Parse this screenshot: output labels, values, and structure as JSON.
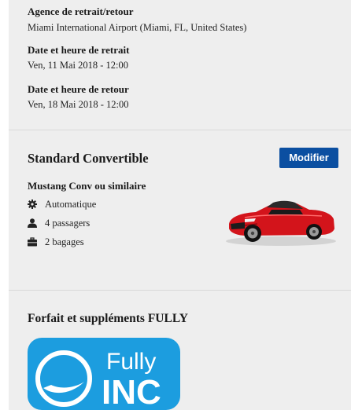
{
  "pickup": {
    "agency_label": "Agence de retrait/retour",
    "agency_value": "Miami International Airport (Miami, FL, United States)",
    "pickup_label": "Date et heure de retrait",
    "pickup_value": "Ven, 11 Mai 2018 - 12:00",
    "return_label": "Date et heure de retour",
    "return_value": "Ven, 18 Mai 2018 - 12:00"
  },
  "vehicle": {
    "category": "Standard Convertible",
    "edit_label": "Modifier",
    "model": "Mustang Conv ou similaire",
    "features": [
      {
        "icon": "gear-icon",
        "label": "Automatique"
      },
      {
        "icon": "person-icon",
        "label": "4 passagers"
      },
      {
        "icon": "suitcase-icon",
        "label": "2 bagages"
      }
    ],
    "car_color": "#d3141b"
  },
  "package": {
    "title": "Forfait et suppléments FULLY",
    "logo_line1": "Fully",
    "logo_line2": "INC",
    "logo_color": "#1c9ddf"
  },
  "colors": {
    "accent": "#0b4fa1",
    "panel_bg": "#eeeeee",
    "separator": "#d9d9d9"
  }
}
